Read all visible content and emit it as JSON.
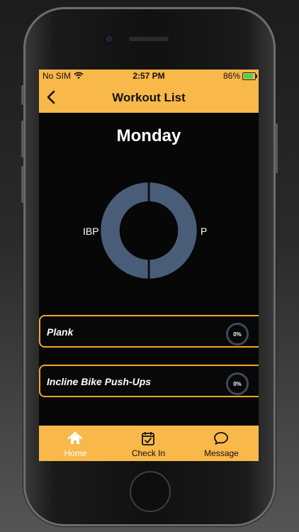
{
  "status_bar": {
    "carrier": "No SIM",
    "time": "2:57 PM",
    "battery": "86%"
  },
  "nav": {
    "title": "Workout List"
  },
  "day": "Monday",
  "chart_data": {
    "type": "pie",
    "style": "donut",
    "categories": [
      "IBP",
      "P"
    ],
    "values": [
      50,
      50
    ],
    "colors": [
      "#4a5d78",
      "#4a5d78"
    ]
  },
  "workouts": [
    {
      "name": "Plank",
      "progress": "0%"
    },
    {
      "name": "Incline Bike Push-Ups",
      "progress": "0%"
    }
  ],
  "tabs": [
    {
      "label": "Home",
      "icon": "home-icon",
      "active": true
    },
    {
      "label": "Check In",
      "icon": "calendar-check-icon",
      "active": false
    },
    {
      "label": "Message",
      "icon": "chat-bubble-icon",
      "active": false
    }
  ],
  "colors": {
    "accent": "#f9b84a",
    "active_tab": "#ffffff",
    "card_border": "#f5a32c",
    "chart": "#4a5d78"
  }
}
